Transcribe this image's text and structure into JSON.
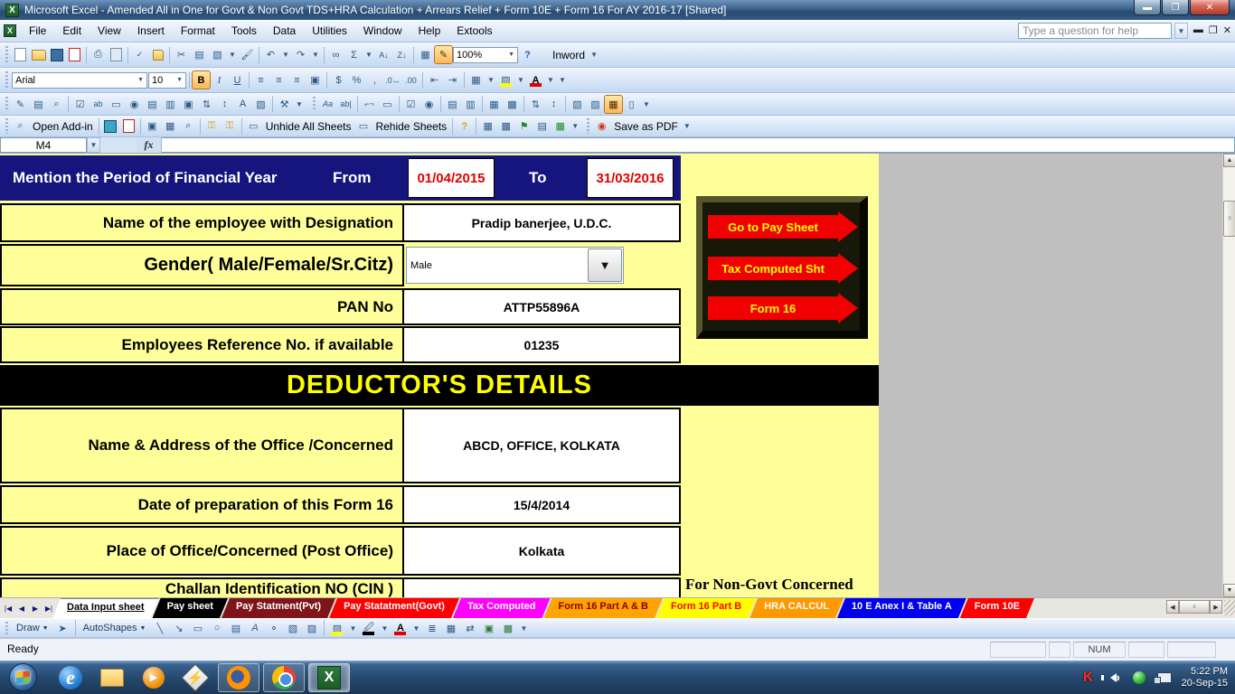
{
  "window": {
    "title": "Microsoft Excel - Amended All in One for Govt & Non Govt TDS+HRA Calculation + Arrears Relief + Form 10E + Form 16 For AY 2016-17  [Shared]"
  },
  "menu": {
    "items": [
      "File",
      "Edit",
      "View",
      "Insert",
      "Format",
      "Tools",
      "Data",
      "Utilities",
      "Window",
      "Help",
      "Extools"
    ],
    "help_box_text": "Type a question for help"
  },
  "standard_toolbar": {
    "zoom_value": "100%",
    "inword_label": "Inword"
  },
  "formatting_toolbar": {
    "font_name": "Arial",
    "font_size": "10",
    "bold": "B",
    "italic": "I",
    "underline": "U"
  },
  "addins_toolbar": {
    "open_addin_label": "Open Add-in",
    "unhide_label": "Unhide All Sheets",
    "rehide_label": "Rehide Sheets",
    "save_pdf_label": "Save as PDF"
  },
  "formula_bar": {
    "name_box": "M4",
    "fx_label": "fx"
  },
  "form": {
    "header": {
      "label": "Mention the Period of Financial Year",
      "from_label": "From",
      "from_value": "01/04/2015",
      "to_label": "To",
      "to_value": "31/03/2016"
    },
    "employee_name": {
      "label": "Name of the employee with Designation",
      "value": "Pradip banerjee, U.D.C."
    },
    "gender": {
      "label": "Gender( Male/Female/Sr.Citz)",
      "value": "Male"
    },
    "pan": {
      "label": "PAN No",
      "value": "ATTP55896A"
    },
    "reference": {
      "label": "Employees Reference No. if available",
      "value": "01235"
    },
    "deductor_banner": "DEDUCTOR'S DETAILS",
    "office": {
      "label": "Name  & Address of the Office /Concerned",
      "value": "ABCD, OFFICE, KOLKATA"
    },
    "prep_date": {
      "label": "Date of preparation of this Form 16",
      "value": "15/4/2014"
    },
    "place": {
      "label": "Place of Office/Concerned (Post Office)",
      "value": "Kolkata"
    },
    "challan": {
      "label": "Challan Identification NO (CIN )"
    },
    "non_govt_note": "For Non-Govt Concerned",
    "nav_buttons": [
      {
        "label": "Go to Pay Sheet",
        "color": "#f00000",
        "text_color": "#ffff00"
      },
      {
        "label": "Tax Computed Sht",
        "color": "#f00000",
        "text_color": "#ffff00"
      },
      {
        "label": "Form 16",
        "color": "#f00000",
        "text_color": "#ffff00"
      }
    ]
  },
  "sheet_tabs": [
    {
      "label": "Data Input sheet",
      "bg": "#ffffff",
      "fg": "#000000",
      "active": true
    },
    {
      "label": "Pay sheet",
      "bg": "#000000",
      "fg": "#ffffff"
    },
    {
      "label": "Pay Statment(Pvt)",
      "bg": "#7e1518",
      "fg": "#ffffff"
    },
    {
      "label": "Pay Statatment(Govt)",
      "bg": "#ff0000",
      "fg": "#ffffff"
    },
    {
      "label": "Tax Computed",
      "bg": "#ff00ff",
      "fg": "#ffffff"
    },
    {
      "label": "Form 16 Part A & B",
      "bg": "#ffa400",
      "fg": "#8b0000"
    },
    {
      "label": "Form 16 Part B",
      "bg": "#ffff00",
      "fg": "#ff0000"
    },
    {
      "label": "HRA CALCUL",
      "bg": "#ff9900",
      "fg": "#ffffff"
    },
    {
      "label": "10 E Anex I & Table A",
      "bg": "#0000ee",
      "fg": "#ffffff"
    },
    {
      "label": "Form 10E",
      "bg": "#ff0000",
      "fg": "#ffffff"
    }
  ],
  "drawing_toolbar": {
    "draw_label": "Draw",
    "autoshapes_label": "AutoShapes"
  },
  "status_bar": {
    "mode": "Ready",
    "num_lock": "NUM"
  },
  "taskbar": {
    "clock_time": "5:22 PM",
    "clock_date": "20-Sep-15"
  }
}
